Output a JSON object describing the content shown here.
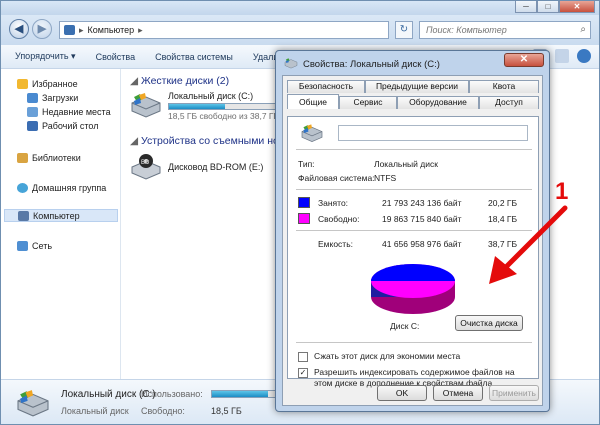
{
  "window": {
    "minimize": "─",
    "maximize": "□",
    "close": "✕"
  },
  "address": {
    "path": "Компьютер",
    "separator": "▸",
    "search_placeholder": "Поиск: Компьютер"
  },
  "toolbar": {
    "organize": "Упорядочить ▾",
    "properties": "Свойства",
    "system_properties": "Свойства системы",
    "uninstall": "Удали"
  },
  "nav": {
    "favorites": "Избранное",
    "downloads": "Загрузки",
    "recent": "Недавние места",
    "desktop": "Рабочий стол",
    "libraries": "Библиотеки",
    "homegroup": "Домашняя группа",
    "computer": "Компьютер",
    "network": "Сеть"
  },
  "main": {
    "hdd_group": "Жесткие диски (2)",
    "removable_group": "Устройства со съемными носителями",
    "drive_c": {
      "name": "Локальный диск (C:)",
      "free": "18,5 ГБ свободно из 38,7 ГБ",
      "used_fraction": 0.52
    },
    "drive_e": {
      "name": "Дисковод BD-ROM (E:)"
    }
  },
  "details": {
    "name": "Локальный диск (C:)",
    "type": "Локальный диск",
    "used_label": "Использовано:",
    "free_label": "Свободно:",
    "free_value": "18,5 ГБ",
    "used_fraction": 0.52
  },
  "dialog": {
    "title": "Свойства: Локальный диск (C:)",
    "close": "✕",
    "tabs_top": [
      "Безопасность",
      "Предыдущие версии",
      "Квота"
    ],
    "tabs_bottom": [
      "Общие",
      "Сервис",
      "Оборудование",
      "Доступ"
    ],
    "type_label": "Тип:",
    "type_value": "Локальный диск",
    "fs_label": "Файловая система:",
    "fs_value": "NTFS",
    "used_label": "Занято:",
    "used_bytes": "21 793 243 136 байт",
    "used_gb": "20,2 ГБ",
    "free_label": "Свободно:",
    "free_bytes": "19 863 715 840 байт",
    "free_gb": "18,4 ГБ",
    "capacity_label": "Емкость:",
    "capacity_bytes": "41 656 958 976 байт",
    "capacity_gb": "38,7 ГБ",
    "disk_label": "Диск C:",
    "cleanup_button": "Очистка диска",
    "compress_label": "Сжать этот диск для экономии места",
    "index_label": "Разрешить индексировать содержимое файлов на этом диске в дополнение к свойствам файла",
    "ok": "OK",
    "cancel": "Отмена",
    "apply": "Применить",
    "used_color": "#0000ff",
    "free_color": "#ff00ff"
  },
  "annotation": {
    "number": "1",
    "color": "#e40b0b"
  }
}
